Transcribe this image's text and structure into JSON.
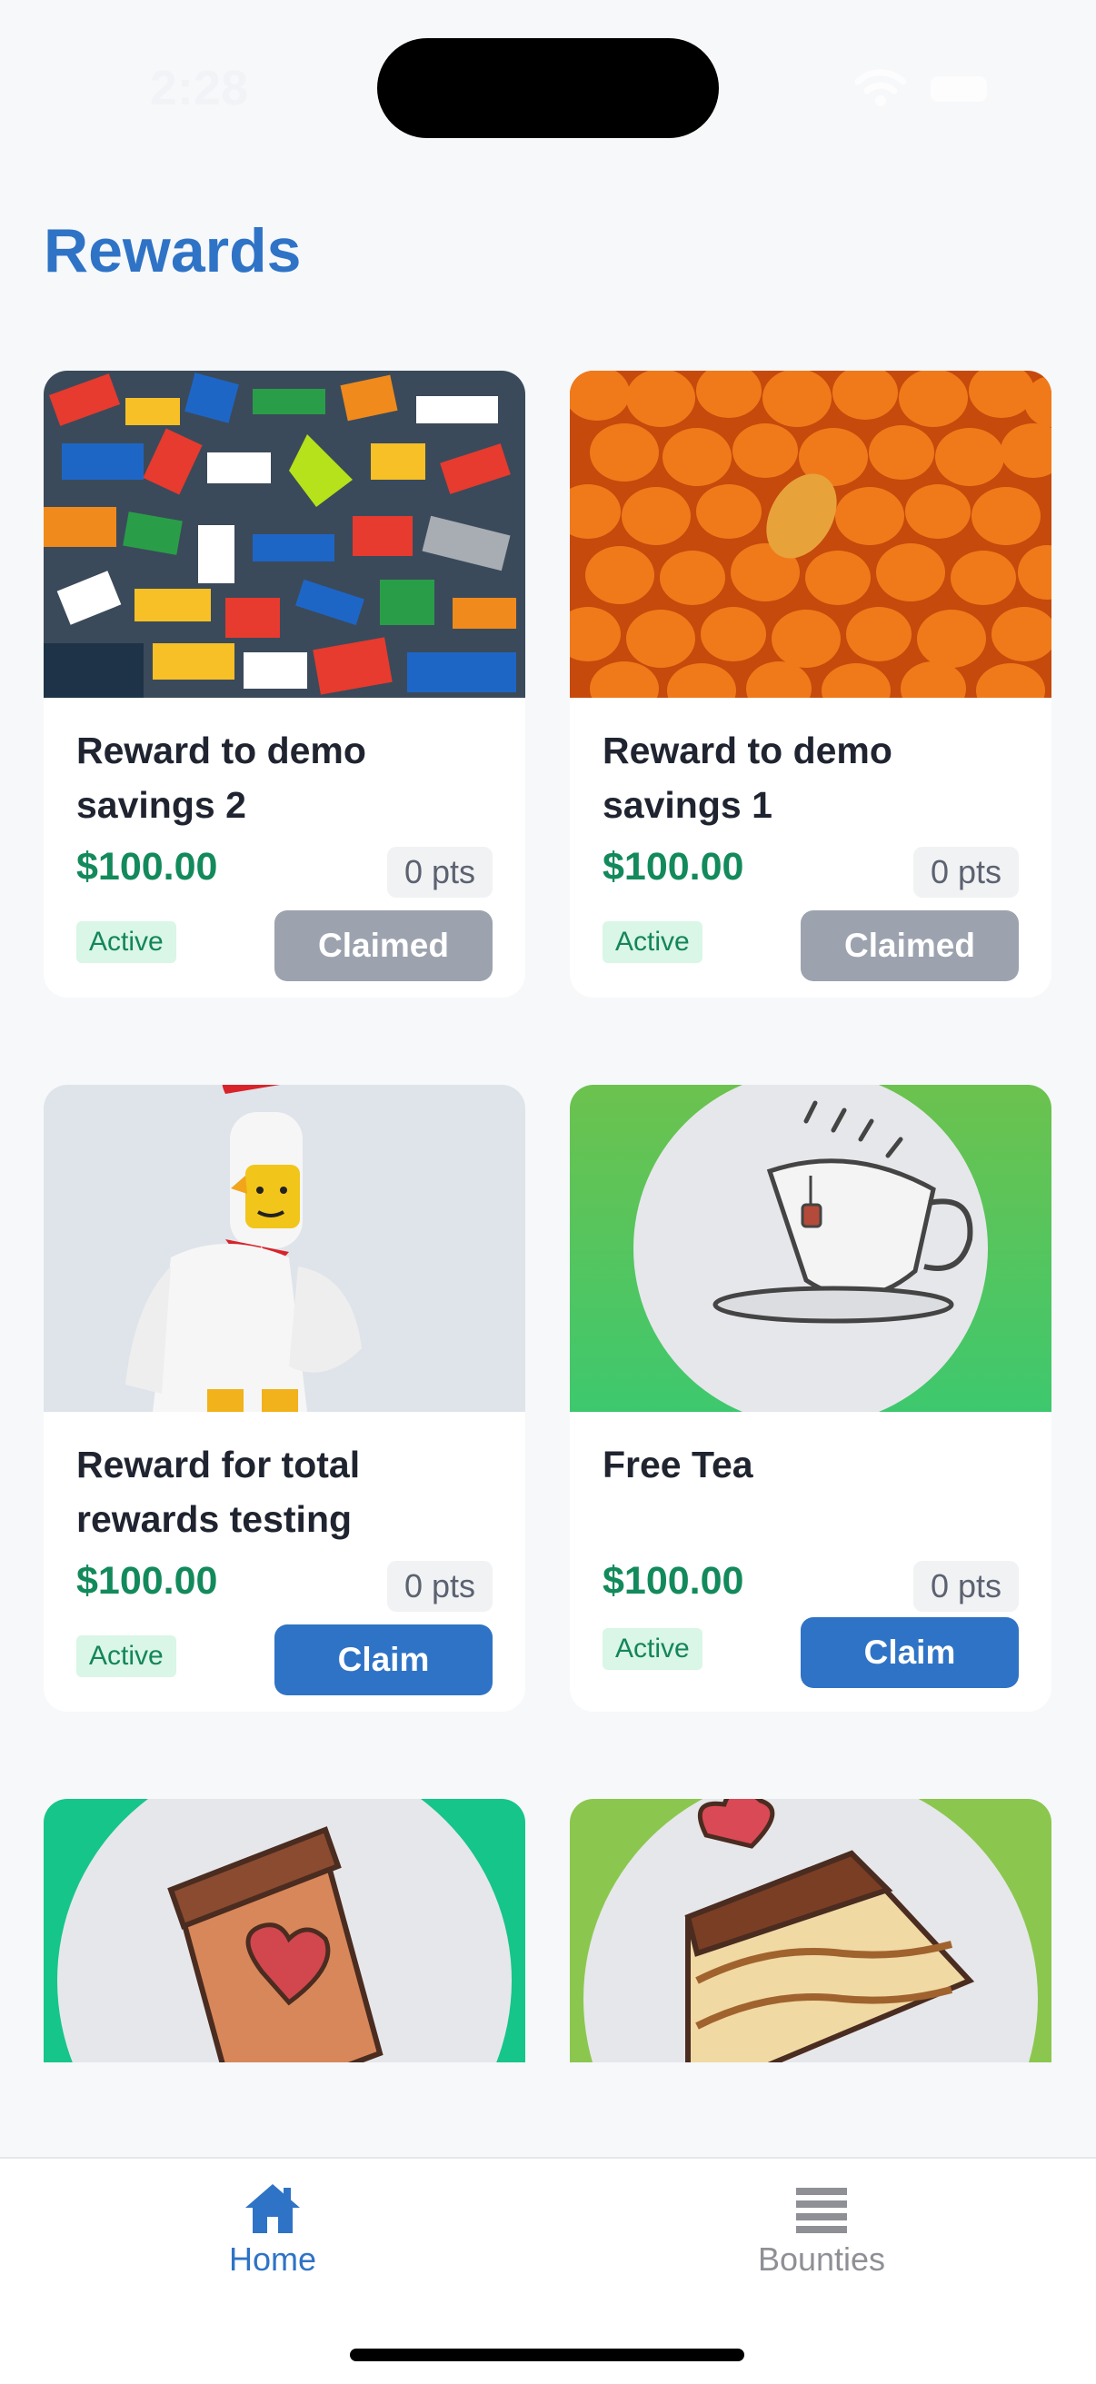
{
  "status_bar": {
    "time": "2:28"
  },
  "page": {
    "title": "Rewards"
  },
  "rewards": [
    {
      "title": "Reward to demo savings 2",
      "price": "$100.00",
      "points": "0 pts",
      "status": "Active",
      "action": "Claimed",
      "image": "lego-bricks-photo"
    },
    {
      "title": "Reward to demo savings 1",
      "price": "$100.00",
      "points": "0 pts",
      "status": "Active",
      "action": "Claimed",
      "image": "pumpkins-photo"
    },
    {
      "title": "Reward for total rewards testing",
      "price": "$100.00",
      "points": "0 pts",
      "status": "Active",
      "action": "Claim",
      "image": "lego-chicken-minifigure-photo"
    },
    {
      "title": "Free Tea",
      "price": "$100.00",
      "points": "0 pts",
      "status": "Active",
      "action": "Claim",
      "image": "tea-cup-illustration"
    },
    {
      "image": "coffee-cup-heart-illustration"
    },
    {
      "image": "cake-slice-heart-illustration"
    }
  ],
  "tabs": [
    {
      "label": "Home",
      "icon": "home-icon",
      "active": true
    },
    {
      "label": "Bounties",
      "icon": "list-icon",
      "active": false
    }
  ],
  "colors": {
    "accent": "#2f73c6",
    "price_green": "#138a5b",
    "claimed_gray": "#9ca3af",
    "active_badge_bg": "#d9f6e6",
    "inactive_tab": "#8e9095"
  }
}
